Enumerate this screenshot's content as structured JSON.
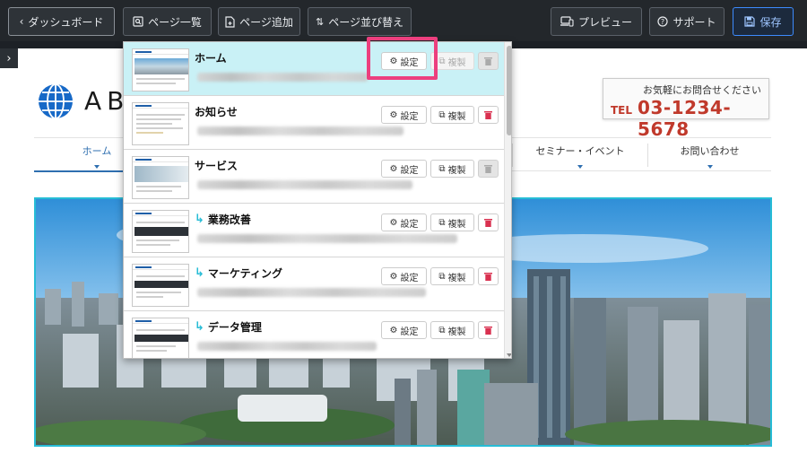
{
  "toolbar": {
    "dashboard_label": "ダッシュボード",
    "page_list_label": "ページ一覧",
    "add_page_label": "ページ追加",
    "sort_pages_label": "ページ並び替え",
    "preview_label": "プレビュー",
    "support_label": "サポート",
    "save_label": "保存"
  },
  "site": {
    "logo_text": "AB",
    "contact_prompt": "お気軽にお問合せください",
    "tel_label": "TEL",
    "tel_number": "03-1234-5678",
    "nav": [
      {
        "label": "ホーム"
      },
      {
        "label": "セミナー・イベント"
      },
      {
        "label": "お問い合わせ"
      }
    ]
  },
  "page_list": {
    "settings_label": "設定",
    "duplicate_label": "複製",
    "pages": [
      {
        "title": "ホーム",
        "child": false
      },
      {
        "title": "お知らせ",
        "child": false
      },
      {
        "title": "サービス",
        "child": false
      },
      {
        "title": "業務改善",
        "child": true
      },
      {
        "title": "マーケティング",
        "child": true
      },
      {
        "title": "データ管理",
        "child": true
      }
    ]
  },
  "colors": {
    "accent": "#27bcd6",
    "highlight": "#ec3f7e",
    "delete": "#d9304f",
    "save": "#3d8bfd",
    "toolbar_bg": "#23272b"
  }
}
